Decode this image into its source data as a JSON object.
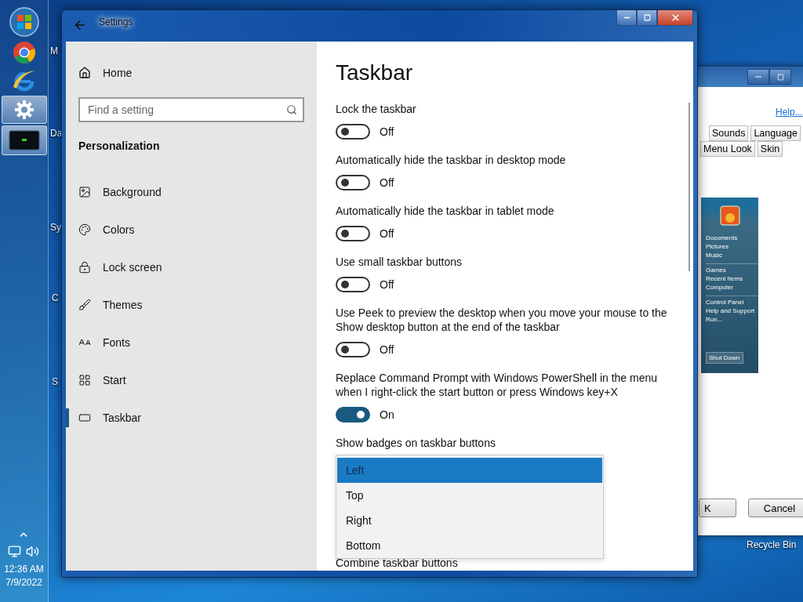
{
  "taskbar": {
    "buttons": [
      {
        "kind": "start",
        "selected": false
      },
      {
        "kind": "round-browser",
        "selected": false
      },
      {
        "kind": "e-browser",
        "selected": false
      },
      {
        "kind": "gear",
        "selected": true
      },
      {
        "kind": "console",
        "selected": true
      }
    ],
    "time": "12:36 AM",
    "date": "7/9/2022"
  },
  "desktop_labels": [
    {
      "text": "M"
    },
    {
      "text": "Da"
    },
    {
      "text": "Sy"
    },
    {
      "text": "C"
    },
    {
      "text": "S"
    },
    {
      "text": "Recycle Bin"
    }
  ],
  "background_window": {
    "link": "Help...",
    "tab_rows": [
      [
        {
          "label": "Sounds"
        },
        {
          "label": "Language"
        }
      ],
      [
        {
          "label": "Menu Look"
        },
        {
          "label": "Skin"
        }
      ]
    ],
    "preview_items": [
      {
        "label": "Documents",
        "divider_before": false
      },
      {
        "label": "Pictures",
        "divider_before": false
      },
      {
        "label": "Music",
        "divider_before": false
      },
      {
        "label": "Games",
        "divider_before": true
      },
      {
        "label": "Recent Items",
        "divider_before": false
      },
      {
        "label": "Computer",
        "divider_before": false
      },
      {
        "label": "Control Panel",
        "divider_before": true
      },
      {
        "label": "Help and Support",
        "divider_before": false
      },
      {
        "label": "Run...",
        "divider_before": false
      }
    ],
    "preview_button": "Shut Down",
    "buttons": [
      "K",
      "Cancel"
    ]
  },
  "settings": {
    "title": "Settings",
    "nav": {
      "home": "Home",
      "search_placeholder": "Find a setting",
      "section": "Personalization",
      "items": [
        {
          "label": "Background",
          "kind": "picture",
          "selected": false
        },
        {
          "label": "Colors",
          "kind": "palette",
          "selected": false
        },
        {
          "label": "Lock screen",
          "kind": "lock",
          "selected": false
        },
        {
          "label": "Themes",
          "kind": "brush",
          "selected": false
        },
        {
          "label": "Fonts",
          "kind": "fonts",
          "selected": false
        },
        {
          "label": "Start",
          "kind": "tiles",
          "selected": false
        },
        {
          "label": "Taskbar",
          "kind": "bar",
          "selected": true
        }
      ]
    },
    "page": {
      "title": "Taskbar",
      "settings": [
        {
          "label": "Lock the taskbar",
          "on": false,
          "state": "Off"
        },
        {
          "label": "Automatically hide the taskbar in desktop mode",
          "on": false,
          "state": "Off"
        },
        {
          "label": "Automatically hide the taskbar in tablet mode",
          "on": false,
          "state": "Off"
        },
        {
          "label": "Use small taskbar buttons",
          "on": false,
          "state": "Off"
        },
        {
          "label": "Use Peek to preview the desktop when you move your mouse to the Show desktop button at the end of the taskbar",
          "on": false,
          "state": "Off"
        },
        {
          "label": "Replace Command Prompt with Windows PowerShell in the menu when I right-click the start button or press Windows key+X",
          "on": true,
          "state": "On"
        }
      ],
      "dropdown": {
        "label": "Show badges on taskbar buttons",
        "options": [
          {
            "label": "Left",
            "selected": true
          },
          {
            "label": "Top",
            "selected": false
          },
          {
            "label": "Right",
            "selected": false
          },
          {
            "label": "Bottom",
            "selected": false
          }
        ]
      },
      "next_label": "Combine taskbar buttons"
    }
  }
}
